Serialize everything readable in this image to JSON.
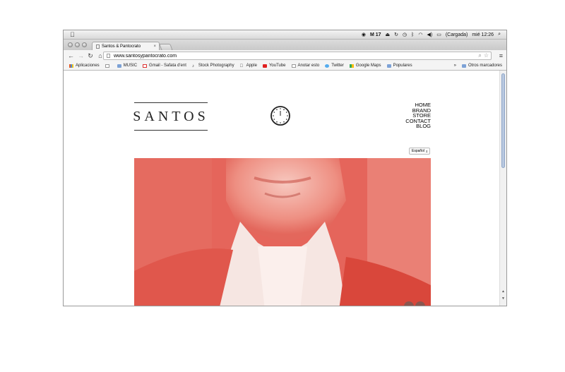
{
  "menubar": {
    "apple": "",
    "calendar_day": "17",
    "battery_text": "(Cargada)",
    "clock": "mié 12:26"
  },
  "browser": {
    "tab_title": "Santos & Pantocrato",
    "tab_close": "×",
    "url": "www.santosypantocrato.com"
  },
  "bookmarks": {
    "items": [
      {
        "label": "Aplicaciones",
        "icon": "grid-icon"
      },
      {
        "label": "",
        "icon": "page-icon"
      },
      {
        "label": "MUSIC",
        "icon": "folder-icon"
      },
      {
        "label": "Gmail - Safata d'ent",
        "icon": "gmail-icon"
      },
      {
        "label": "Stock Photography",
        "icon": "music-icon"
      },
      {
        "label": "Apple",
        "icon": "apple-icon"
      },
      {
        "label": "YouTube",
        "icon": "youtube-icon"
      },
      {
        "label": "Anotar esto",
        "icon": "page-icon"
      },
      {
        "label": "Twitter",
        "icon": "twitter-icon"
      },
      {
        "label": "Google Maps",
        "icon": "maps-icon"
      },
      {
        "label": "Populares",
        "icon": "folder-icon"
      }
    ],
    "overflow": "»",
    "other": "Otros marcadores"
  },
  "site": {
    "logo": "SANTOS",
    "nav": [
      "HOME",
      "BRAND",
      "STORE",
      "CONTACT",
      "BLOG"
    ],
    "language": "Español"
  },
  "colors": {
    "hero": "#e5645a"
  }
}
